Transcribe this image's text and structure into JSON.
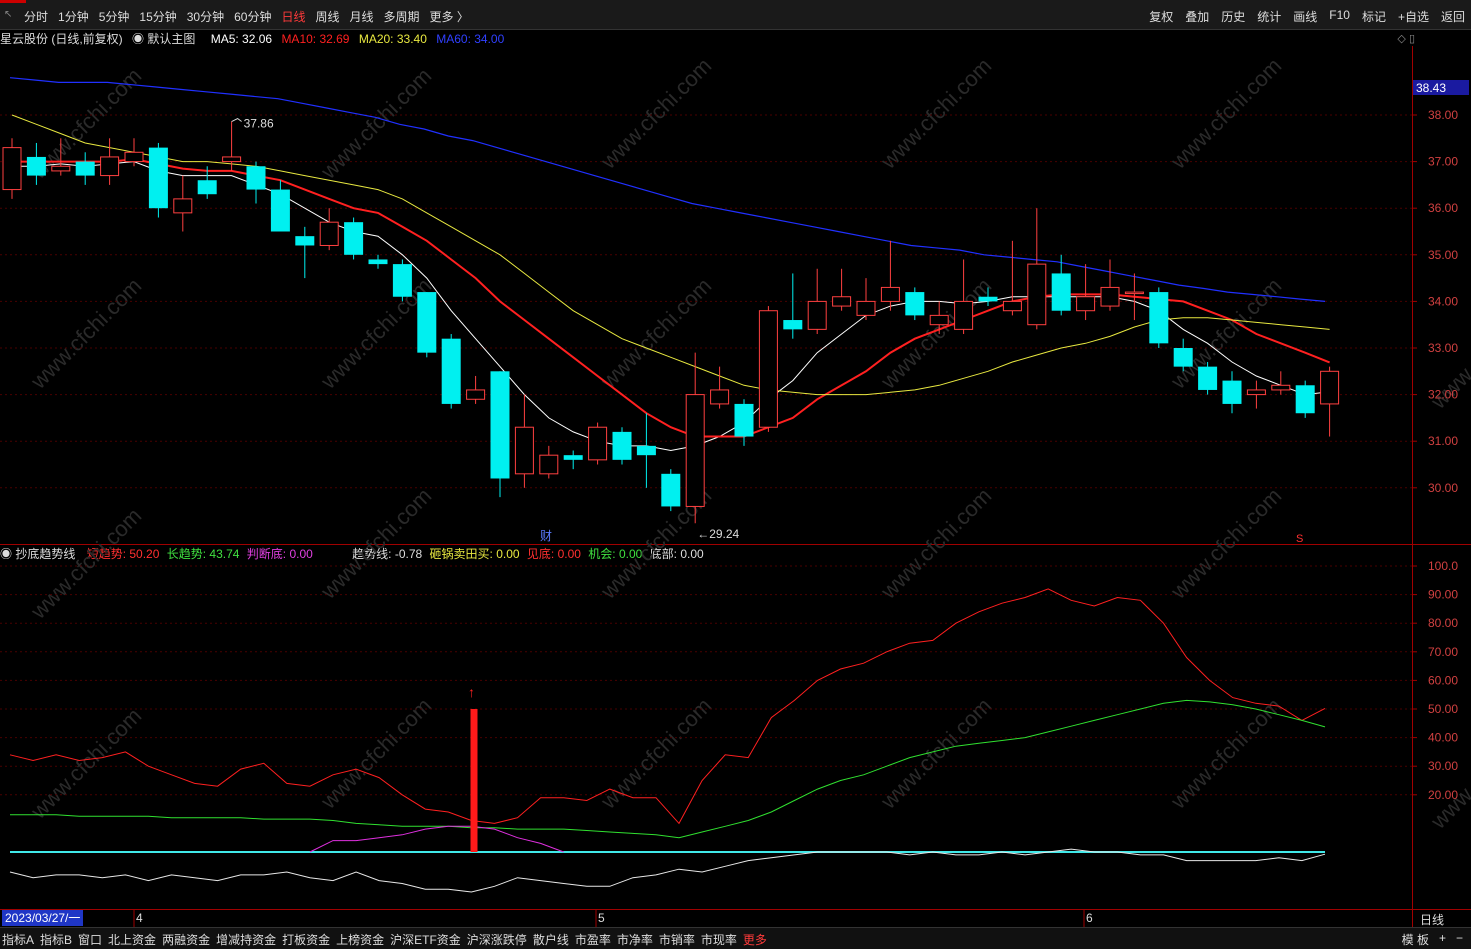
{
  "toolbar": {
    "periods": [
      "分时",
      "1分钟",
      "5分钟",
      "15分钟",
      "30分钟",
      "60分钟",
      "日线",
      "周线",
      "月线",
      "多周期",
      "更多 〉"
    ],
    "active_period": "日线",
    "tools": [
      "复权",
      "叠加",
      "历史",
      "统计",
      "画线",
      "F10",
      "标记",
      "+自选",
      "返回"
    ]
  },
  "main_chart": {
    "title": "星云股份 (日线,前复权)",
    "template": "默认主图",
    "ma5": "MA5: 32.06",
    "ma10": "MA10: 32.69",
    "ma20": "MA20: 33.40",
    "ma60": "MA60: 34.00",
    "high_mark": "37.86",
    "low_mark": "29.24",
    "current_price_tag": "38.43",
    "fin_marker": "财",
    "s_marker": "S",
    "price_ticks": [
      "38.00",
      "37.00",
      "36.00",
      "35.00",
      "34.00",
      "33.00",
      "32.00",
      "31.00",
      "30.00"
    ],
    "colors": {
      "ma5": "#ffffff",
      "ma10": "#ff2020",
      "ma20": "#e8e840",
      "ma60": "#2030ff",
      "up": "#ff4040",
      "down": "#00f0f0"
    }
  },
  "indicator": {
    "name": "抄底趋势线",
    "short_trend": "短趋势: 50.20",
    "long_trend": "长趋势: 43.74",
    "judge_bottom": "判断底: 0.00",
    "trend_line": "趋势线: -0.78",
    "sell_buy": "砸锅卖田买: 0.00",
    "see_bottom": "见底: 0.00",
    "chance": "机会: 0.00",
    "bottom": "底部: 0.00",
    "ticks": [
      "100.0",
      "90.00",
      "80.00",
      "70.00",
      "60.00",
      "50.00",
      "40.00",
      "30.00",
      "20.00"
    ]
  },
  "date_axis": {
    "cursor_date": "2023/03/27/一",
    "month_labels": [
      "4",
      "5",
      "6"
    ],
    "period_label": "日线"
  },
  "bottom_tabs": [
    "指标A",
    "指标B",
    "窗口",
    "北上资金",
    "两融资金",
    "增减持资金",
    "打板资金",
    "上榜资金",
    "沪深ETF资金",
    "沪深涨跌停",
    "散户线",
    "市盈率",
    "市净率",
    "市销率",
    "市现率",
    "更多"
  ],
  "bottom_right": [
    "模 板",
    "+",
    "−"
  ],
  "watermark": "www.cfchi.com",
  "chart_data": [
    {
      "type": "candlestick",
      "title": "星云股份 (日线,前复权)",
      "ylim": [
        29.0,
        38.8
      ],
      "candles": [
        {
          "o": 36.4,
          "c": 37.3,
          "h": 37.5,
          "l": 36.2
        },
        {
          "o": 37.1,
          "c": 36.7,
          "h": 37.4,
          "l": 36.5
        },
        {
          "o": 36.8,
          "c": 36.9,
          "h": 37.5,
          "l": 36.7
        },
        {
          "o": 37.0,
          "c": 36.7,
          "h": 37.2,
          "l": 36.5
        },
        {
          "o": 36.7,
          "c": 37.1,
          "h": 37.5,
          "l": 36.5
        },
        {
          "o": 37.0,
          "c": 37.2,
          "h": 37.5,
          "l": 36.9
        },
        {
          "o": 37.3,
          "c": 36.0,
          "h": 37.4,
          "l": 35.8
        },
        {
          "o": 35.9,
          "c": 36.2,
          "h": 36.7,
          "l": 35.5
        },
        {
          "o": 36.6,
          "c": 36.3,
          "h": 36.9,
          "l": 36.2
        },
        {
          "o": 37.0,
          "c": 37.1,
          "h": 37.86,
          "l": 36.8
        },
        {
          "o": 36.9,
          "c": 36.4,
          "h": 37.0,
          "l": 36.1
        },
        {
          "o": 36.4,
          "c": 35.5,
          "h": 36.6,
          "l": 35.5
        },
        {
          "o": 35.4,
          "c": 35.2,
          "h": 35.6,
          "l": 34.5
        },
        {
          "o": 35.2,
          "c": 35.7,
          "h": 36.0,
          "l": 35.1
        },
        {
          "o": 35.7,
          "c": 35.0,
          "h": 35.8,
          "l": 34.9
        },
        {
          "o": 34.9,
          "c": 34.8,
          "h": 35.0,
          "l": 34.7
        },
        {
          "o": 34.8,
          "c": 34.1,
          "h": 34.9,
          "l": 34.0
        },
        {
          "o": 34.2,
          "c": 32.9,
          "h": 34.2,
          "l": 32.8
        },
        {
          "o": 33.2,
          "c": 31.8,
          "h": 33.3,
          "l": 31.7
        },
        {
          "o": 31.9,
          "c": 32.1,
          "h": 32.4,
          "l": 31.8
        },
        {
          "o": 32.5,
          "c": 30.2,
          "h": 32.5,
          "l": 29.8
        },
        {
          "o": 30.3,
          "c": 31.3,
          "h": 32.0,
          "l": 30.0
        },
        {
          "o": 30.3,
          "c": 30.7,
          "h": 30.9,
          "l": 30.2
        },
        {
          "o": 30.7,
          "c": 30.6,
          "h": 30.8,
          "l": 30.4
        },
        {
          "o": 30.6,
          "c": 31.3,
          "h": 31.4,
          "l": 30.5
        },
        {
          "o": 31.2,
          "c": 30.6,
          "h": 31.3,
          "l": 30.5
        },
        {
          "o": 30.9,
          "c": 30.7,
          "h": 31.6,
          "l": 30.0
        },
        {
          "o": 30.3,
          "c": 29.6,
          "h": 30.4,
          "l": 29.5
        },
        {
          "o": 29.6,
          "c": 32.0,
          "h": 32.9,
          "l": 29.24
        },
        {
          "o": 31.8,
          "c": 32.1,
          "h": 32.6,
          "l": 31.7
        },
        {
          "o": 31.8,
          "c": 31.1,
          "h": 31.9,
          "l": 30.9
        },
        {
          "o": 31.3,
          "c": 33.8,
          "h": 33.9,
          "l": 31.2
        },
        {
          "o": 33.6,
          "c": 33.4,
          "h": 34.6,
          "l": 33.2
        },
        {
          "o": 33.4,
          "c": 34.0,
          "h": 34.7,
          "l": 33.3
        },
        {
          "o": 33.9,
          "c": 34.1,
          "h": 34.7,
          "l": 33.8
        },
        {
          "o": 33.7,
          "c": 34.0,
          "h": 34.5,
          "l": 33.6
        },
        {
          "o": 34.0,
          "c": 34.3,
          "h": 35.3,
          "l": 33.8
        },
        {
          "o": 34.2,
          "c": 33.7,
          "h": 34.3,
          "l": 33.6
        },
        {
          "o": 33.5,
          "c": 33.7,
          "h": 34.0,
          "l": 33.3
        },
        {
          "o": 33.4,
          "c": 34.0,
          "h": 34.9,
          "l": 33.3
        },
        {
          "o": 34.1,
          "c": 34.0,
          "h": 34.3,
          "l": 33.9
        },
        {
          "o": 33.8,
          "c": 34.0,
          "h": 35.3,
          "l": 33.7
        },
        {
          "o": 33.5,
          "c": 34.8,
          "h": 36.0,
          "l": 33.4
        },
        {
          "o": 34.6,
          "c": 33.8,
          "h": 35.0,
          "l": 33.7
        },
        {
          "o": 33.8,
          "c": 34.1,
          "h": 34.8,
          "l": 33.6
        },
        {
          "o": 33.9,
          "c": 34.3,
          "h": 34.9,
          "l": 33.8
        },
        {
          "o": 34.2,
          "c": 34.2,
          "h": 34.6,
          "l": 33.6
        },
        {
          "o": 34.2,
          "c": 33.1,
          "h": 34.3,
          "l": 33.0
        },
        {
          "o": 33.0,
          "c": 32.6,
          "h": 33.2,
          "l": 32.5
        },
        {
          "o": 32.6,
          "c": 32.1,
          "h": 32.7,
          "l": 32.0
        },
        {
          "o": 32.3,
          "c": 31.8,
          "h": 32.5,
          "l": 31.6
        },
        {
          "o": 32.0,
          "c": 32.1,
          "h": 32.3,
          "l": 31.7
        },
        {
          "o": 32.1,
          "c": 32.2,
          "h": 32.5,
          "l": 32.0
        },
        {
          "o": 32.2,
          "c": 31.6,
          "h": 32.3,
          "l": 31.5
        },
        {
          "o": 31.8,
          "c": 32.5,
          "h": 32.6,
          "l": 31.1
        }
      ],
      "series": [
        {
          "name": "MA5",
          "values": [
            36.9,
            36.9,
            36.95,
            36.9,
            36.95,
            37.0,
            36.8,
            36.7,
            36.7,
            36.7,
            36.5,
            36.3,
            36.0,
            35.7,
            35.5,
            35.4,
            35.0,
            34.5,
            33.8,
            33.2,
            32.6,
            32.0,
            31.5,
            31.2,
            31.0,
            30.9,
            30.9,
            30.8,
            30.9,
            31.1,
            31.4,
            31.9,
            32.3,
            32.9,
            33.3,
            33.7,
            33.9,
            34.0,
            34.0,
            33.95,
            34.0,
            34.1,
            34.1,
            34.1,
            34.1,
            34.1,
            34.0,
            33.8,
            33.4,
            33.1,
            32.7,
            32.4,
            32.2,
            32.0,
            32.06
          ]
        },
        {
          "name": "MA10",
          "values": [
            37.0,
            37.0,
            37.0,
            37.0,
            37.0,
            37.05,
            36.95,
            36.85,
            36.8,
            36.8,
            36.7,
            36.6,
            36.4,
            36.2,
            36.0,
            35.9,
            35.6,
            35.3,
            34.9,
            34.5,
            34.0,
            33.6,
            33.2,
            32.8,
            32.4,
            32.0,
            31.6,
            31.3,
            31.1,
            31.1,
            31.1,
            31.3,
            31.5,
            31.9,
            32.2,
            32.5,
            32.9,
            33.2,
            33.4,
            33.6,
            33.8,
            34.0,
            34.1,
            34.15,
            34.15,
            34.15,
            34.1,
            34.05,
            34.0,
            33.8,
            33.6,
            33.3,
            33.1,
            32.9,
            32.69
          ]
        },
        {
          "name": "MA20",
          "values": [
            38.0,
            37.8,
            37.6,
            37.4,
            37.3,
            37.2,
            37.1,
            37.0,
            37.0,
            36.95,
            36.9,
            36.8,
            36.7,
            36.6,
            36.5,
            36.4,
            36.2,
            35.9,
            35.6,
            35.3,
            35.0,
            34.6,
            34.2,
            33.8,
            33.5,
            33.2,
            33.0,
            32.8,
            32.6,
            32.4,
            32.2,
            32.1,
            32.05,
            32.0,
            32.0,
            32.0,
            32.05,
            32.1,
            32.2,
            32.35,
            32.5,
            32.7,
            32.85,
            33.0,
            33.1,
            33.25,
            33.45,
            33.6,
            33.65,
            33.65,
            33.6,
            33.55,
            33.5,
            33.45,
            33.4
          ]
        },
        {
          "name": "MA60",
          "values": [
            38.8,
            38.75,
            38.7,
            38.7,
            38.7,
            38.65,
            38.6,
            38.55,
            38.5,
            38.45,
            38.4,
            38.35,
            38.25,
            38.15,
            38.05,
            37.95,
            37.8,
            37.7,
            37.55,
            37.45,
            37.3,
            37.15,
            37.0,
            36.85,
            36.7,
            36.55,
            36.4,
            36.25,
            36.1,
            36.0,
            35.9,
            35.8,
            35.7,
            35.6,
            35.5,
            35.4,
            35.3,
            35.2,
            35.15,
            35.1,
            35.0,
            34.95,
            34.9,
            34.85,
            34.75,
            34.65,
            34.55,
            34.45,
            34.35,
            34.28,
            34.2,
            34.15,
            34.1,
            34.05,
            34.0
          ]
        }
      ]
    },
    {
      "type": "line",
      "title": "抄底趋势线",
      "ylim": [
        -10,
        106
      ],
      "series": [
        {
          "name": "短趋势",
          "values": [
            34,
            32,
            34,
            32,
            33,
            35,
            30,
            27,
            24,
            23,
            29,
            31,
            24,
            23,
            27,
            29,
            26,
            20,
            15,
            14,
            11,
            10,
            12,
            19,
            19,
            18,
            22,
            19,
            19,
            10,
            25,
            34,
            33,
            47,
            53,
            60,
            64,
            66,
            70,
            73,
            74,
            80,
            84,
            87,
            89,
            92,
            88,
            86,
            89,
            88,
            80,
            68,
            60,
            54,
            52,
            51,
            46,
            50.2
          ]
        },
        {
          "name": "长趋势",
          "values": [
            13,
            13,
            13,
            12.5,
            12.5,
            12.5,
            12.5,
            12,
            12,
            12,
            12,
            11.5,
            11.5,
            11.5,
            11,
            10,
            9.5,
            9,
            9,
            9,
            8.5,
            8.5,
            8,
            8,
            8,
            7.5,
            7,
            6.5,
            6,
            5,
            7,
            9,
            11,
            14,
            18,
            22,
            25,
            27,
            30,
            33,
            35,
            37,
            38,
            39,
            40,
            42,
            44,
            46,
            48,
            50,
            52,
            53,
            52.5,
            51.5,
            50,
            48,
            46,
            43.74
          ]
        },
        {
          "name": "判断底",
          "values": [
            0,
            0,
            0,
            0,
            0,
            0,
            0,
            0,
            0,
            0,
            0,
            0,
            0,
            0,
            4,
            4,
            5,
            6,
            8,
            9,
            9,
            8,
            5,
            3,
            0,
            0,
            0,
            0,
            0,
            0,
            0,
            0,
            0,
            0,
            0,
            0,
            0,
            0,
            0,
            0,
            0,
            0,
            0,
            0,
            0,
            0,
            0,
            0,
            0,
            0,
            0,
            0,
            0,
            0,
            0,
            0,
            0,
            0
          ]
        },
        {
          "name": "趋势线",
          "values": [
            -7,
            -9,
            -8,
            -8,
            -9,
            -8,
            -10,
            -8,
            -9,
            -10,
            -8,
            -8,
            -7,
            -9,
            -10,
            -7,
            -10,
            -11,
            -13,
            -13,
            -14,
            -12,
            -9,
            -10,
            -11,
            -12,
            -12,
            -9,
            -8,
            -6,
            -7,
            -5,
            -3,
            -2,
            -1,
            0,
            0,
            0,
            0,
            -1,
            0,
            -1,
            -1,
            0,
            -1,
            0,
            1,
            0,
            0,
            -1,
            -1,
            -3,
            -3,
            -3,
            -3,
            -2,
            -3,
            -0.78
          ]
        }
      ],
      "signals": [
        {
          "name": "砸锅卖田买",
          "index": 20,
          "value": 50
        }
      ]
    }
  ]
}
